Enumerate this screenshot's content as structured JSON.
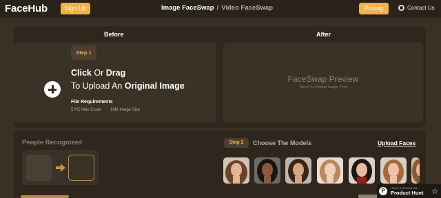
{
  "header": {
    "logo": "FaceHub",
    "signup_label": "Sign Up",
    "nav": {
      "active": "Image FaceSwap",
      "separator": "/",
      "inactive": "Video FaceSwap"
    },
    "pricing_label": "Pricing",
    "contact_label": "Contact Us"
  },
  "swap": {
    "before_label": "Before",
    "after_label": "After",
    "step1": "Step 1",
    "upload": {
      "click": "Click",
      "or": "Or",
      "drag": "Drag",
      "to_upload_an": "To Upload An",
      "original_image": "Original Image"
    },
    "requirements": {
      "title": "File Requirements",
      "max_count": "5 PC Max Count",
      "image_size": "10M Image Size"
    },
    "preview": {
      "title": "FaceSwap Preview",
      "subtitle": "Need To Upload Image First"
    }
  },
  "models": {
    "people_title": "People Recognized",
    "step2": "Step 2",
    "choose_title": "Choose The Models",
    "upload_faces_label": "Upload Faces"
  },
  "product_hunt": {
    "small": "LEAVE A REVIEW ON",
    "name": "Product Hunt",
    "logo_letter": "P"
  },
  "colors": {
    "accent": "#f1b24a",
    "background": "#3a3024",
    "panel": "#2f271e"
  }
}
